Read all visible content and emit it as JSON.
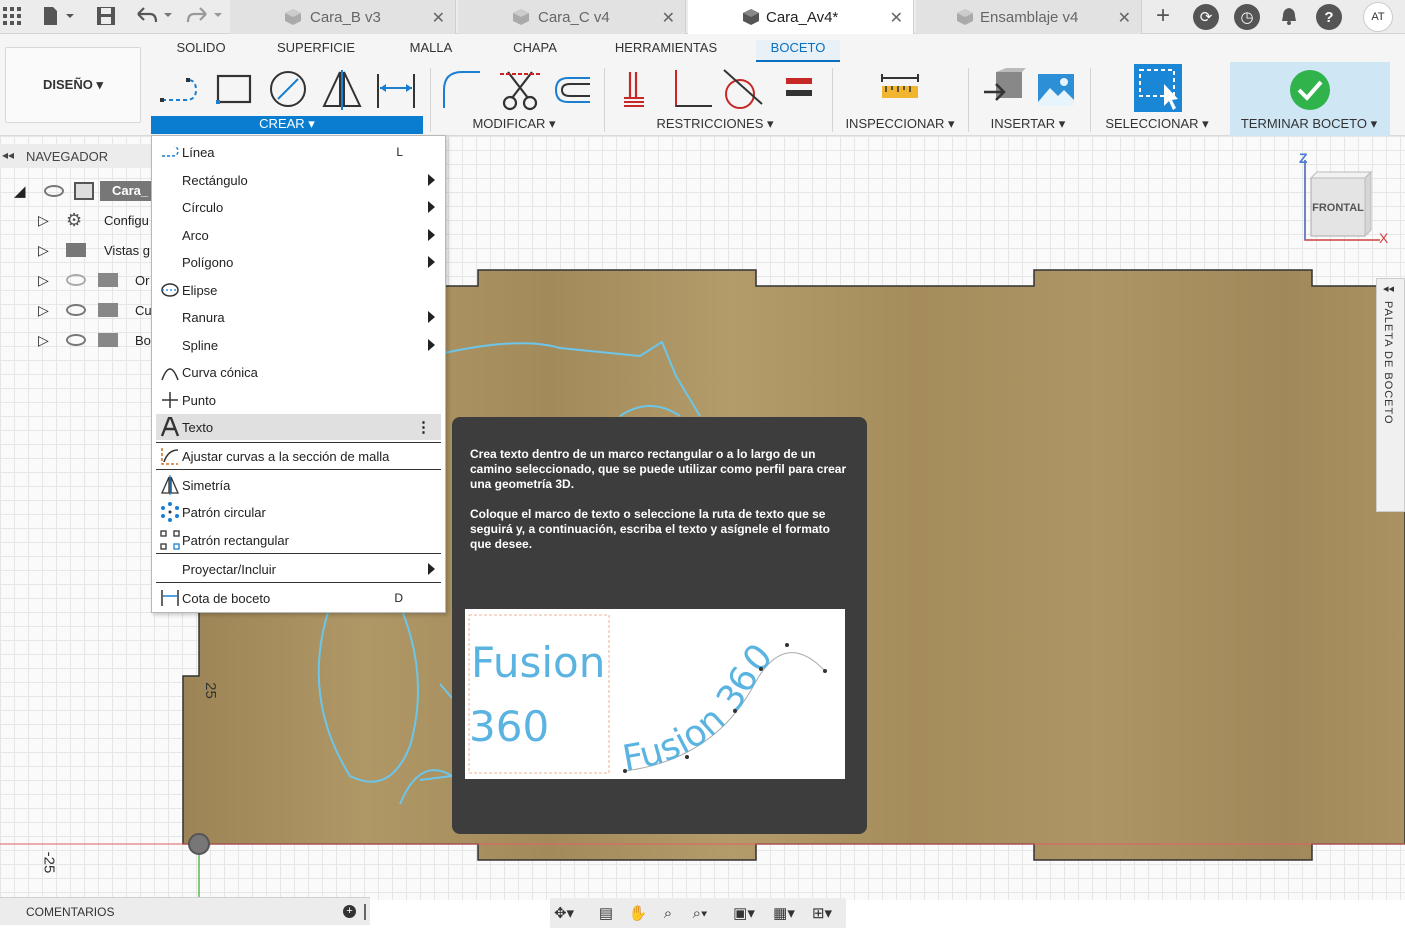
{
  "document_tabs": [
    {
      "label": "Cara_B v3",
      "active": false
    },
    {
      "label": "Cara_C v4",
      "active": false
    },
    {
      "label": "Cara_Av4*",
      "active": true
    },
    {
      "label": "Ensamblaje v4",
      "active": false
    }
  ],
  "user": {
    "initials": "AT"
  },
  "ribbon": {
    "tabs": [
      "SOLIDO",
      "SUPERFICIE",
      "MALLA",
      "CHAPA",
      "HERRAMIENTAS",
      "BOCETO"
    ],
    "active_tab": "BOCETO",
    "workspace": "DISEÑO ▾",
    "groups": {
      "crear": "CREAR ▾",
      "modificar": "MODIFICAR ▾",
      "restricciones": "RESTRICCIONES ▾",
      "inspeccionar": "INSPECCIONAR ▾",
      "insertar": "INSERTAR ▾",
      "seleccionar": "SELECCIONAR ▾",
      "terminar": "TERMINAR BOCETO ▾"
    }
  },
  "browser": {
    "title": "NAVEGADOR",
    "items": [
      {
        "label": "Cara_",
        "icon": "component-icon",
        "visible": true
      },
      {
        "label": "Configu",
        "icon": "gear-icon",
        "visible": null
      },
      {
        "label": "Vistas g",
        "icon": "folder-icon",
        "visible": null
      },
      {
        "label": "Or",
        "icon": "folder-icon",
        "visible": false
      },
      {
        "label": "Cu",
        "icon": "folder-icon",
        "visible": true
      },
      {
        "label": "Bo",
        "icon": "folder-icon",
        "visible": true
      }
    ]
  },
  "crear_menu": {
    "items": [
      {
        "label": "Línea",
        "shortcut": "L",
        "submenu": false,
        "icon": "line-icon"
      },
      {
        "label": "Rectángulo",
        "shortcut": "",
        "submenu": true,
        "icon": ""
      },
      {
        "label": "Círculo",
        "shortcut": "",
        "submenu": true,
        "icon": ""
      },
      {
        "label": "Arco",
        "shortcut": "",
        "submenu": true,
        "icon": ""
      },
      {
        "label": "Polígono",
        "shortcut": "",
        "submenu": true,
        "icon": ""
      },
      {
        "label": "Elipse",
        "shortcut": "",
        "submenu": false,
        "icon": "ellipse-icon"
      },
      {
        "label": "Ranura",
        "shortcut": "",
        "submenu": true,
        "icon": ""
      },
      {
        "label": "Spline",
        "shortcut": "",
        "submenu": true,
        "icon": ""
      },
      {
        "label": "Curva cónica",
        "shortcut": "",
        "submenu": false,
        "icon": "conic-curve-icon"
      },
      {
        "label": "Punto",
        "shortcut": "",
        "submenu": false,
        "icon": "point-icon"
      },
      {
        "label": "Texto",
        "shortcut": "",
        "submenu": false,
        "icon": "text-icon",
        "highlighted": true
      },
      {
        "label": "Ajustar curvas a la sección de malla",
        "shortcut": "",
        "submenu": false,
        "icon": "fit-curves-icon"
      },
      {
        "label": "Simetría",
        "shortcut": "",
        "submenu": false,
        "icon": "mirror-icon"
      },
      {
        "label": "Patrón circular",
        "shortcut": "",
        "submenu": false,
        "icon": "circular-pattern-icon"
      },
      {
        "label": "Patrón rectangular",
        "shortcut": "",
        "submenu": false,
        "icon": "rectangular-pattern-icon"
      },
      {
        "label": "Proyectar/Incluir",
        "shortcut": "",
        "submenu": true,
        "icon": ""
      },
      {
        "label": "Cota de boceto",
        "shortcut": "D",
        "submenu": false,
        "icon": "sketch-dimension-icon"
      }
    ]
  },
  "tooltip": {
    "paragraph1": "Crea texto dentro de un marco rectangular o a lo largo de un camino seleccionado, que se puede utilizar como perfil para crear una geometría 3D.",
    "paragraph2": "Coloque el marco de texto o seleccione la ruta de texto que se seguirá y, a continuación, escriba el texto y asígnele el formato que desee.",
    "illustration": {
      "box_line1": "Fusion",
      "box_line2": "360",
      "path_text": "Fusion 360"
    }
  },
  "viewcube": {
    "face": "FRONTAL",
    "axis_z": "Z",
    "axis_x": "X"
  },
  "palette": {
    "label": "PALETA DE BOCETO"
  },
  "canvas": {
    "dim_25": "25",
    "dim_neg25": "-25"
  },
  "bottom": {
    "comments": "COMENTARIOS"
  },
  "colors": {
    "accent": "#0b7dd0",
    "wood": "#a88e5e",
    "tooltip_bg": "#3d3d3d",
    "sketch_line": "#6cc6ea"
  }
}
